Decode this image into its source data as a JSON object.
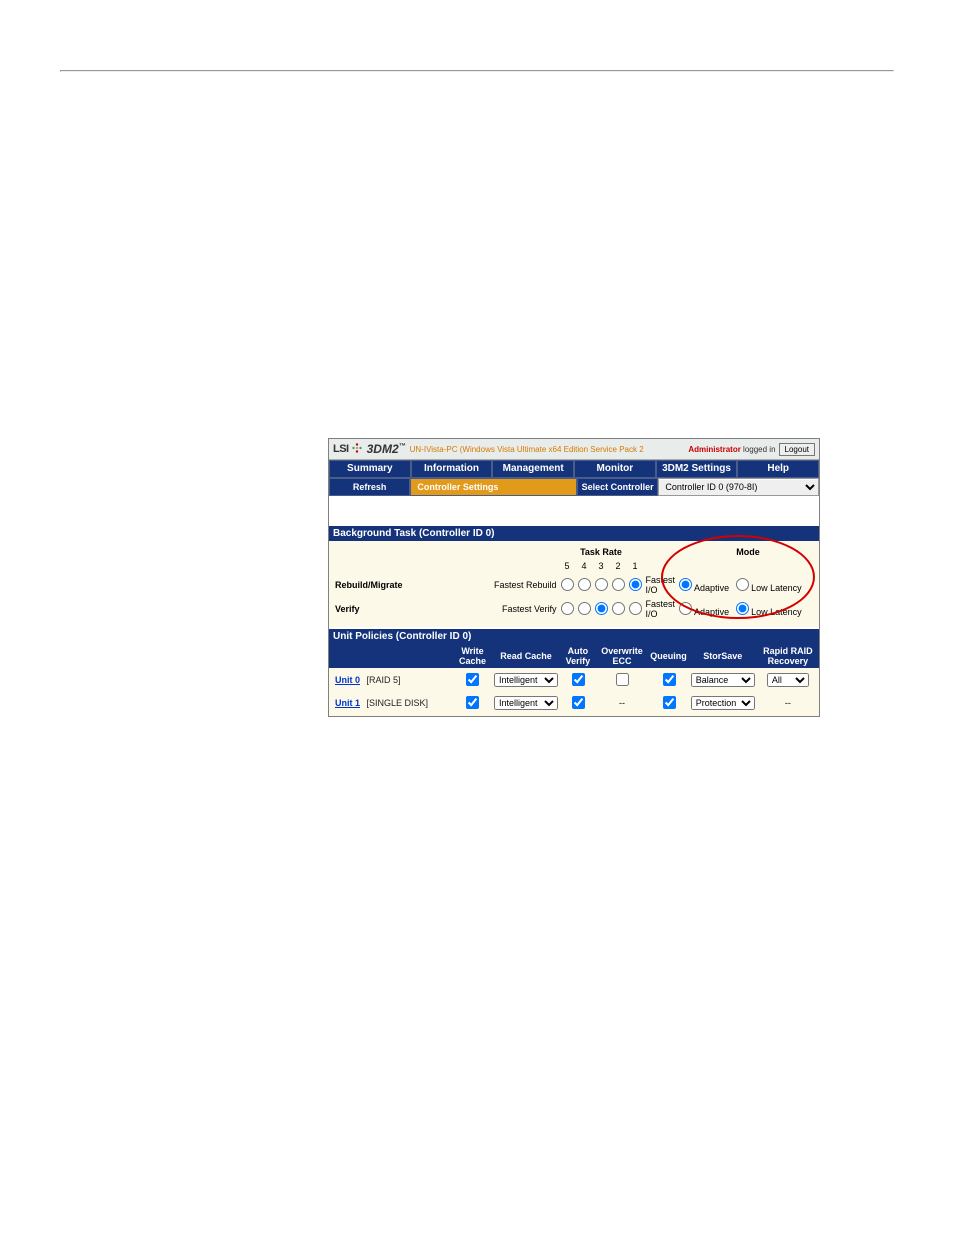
{
  "titlebar": {
    "logo": "LSI",
    "product": "3DM2",
    "tm": "™",
    "os_text": "UN-IVista-PC (Windows Vista Ultimate x64 Edition Service Pack 2",
    "login_prefix": "Administrator",
    "login_suffix": " logged in",
    "logout": "Logout"
  },
  "menu": {
    "row1": [
      "Summary",
      "Information",
      "Management",
      "Monitor",
      "3DM2 Settings",
      "Help"
    ],
    "row2_refresh": "Refresh",
    "row2_controller": "Controller Settings",
    "row2_select_label": "Select Controller",
    "row2_select_value": "Controller ID 0 (970-8I)"
  },
  "bg_task": {
    "header": "Background Task (Controller ID 0)",
    "task_rate_label": "Task Rate",
    "mode_label": "Mode",
    "ticks": [
      "5",
      "4",
      "3",
      "2",
      "1"
    ],
    "rows": [
      {
        "label": "Rebuild/Migrate",
        "left_hint": "Fastest Rebuild",
        "right_hint": "Fastest I/O",
        "selected_rate_index": 4,
        "mode_selected": "adaptive"
      },
      {
        "label": "Verify",
        "left_hint": "Fastest Verify",
        "right_hint": "Fastest I/O",
        "selected_rate_index": 2,
        "mode_selected": "low"
      }
    ],
    "mode_adaptive": "Adaptive",
    "mode_low": "Low Latency"
  },
  "policies": {
    "header": "Unit Policies (Controller ID 0)",
    "cols": [
      "",
      "Write Cache",
      "Read Cache",
      "Auto Verify",
      "Overwrite ECC",
      "Queuing",
      "StorSave",
      "Rapid RAID Recovery"
    ],
    "rows": [
      {
        "unit": "Unit 0",
        "raid": "[RAID 5]",
        "write_cache": true,
        "read_cache": "Intelligent",
        "auto_verify": true,
        "overwrite_ecc": false,
        "queuing": true,
        "storsave": "Balance",
        "rapid_raid": "All"
      },
      {
        "unit": "Unit 1",
        "raid": "[SINGLE DISK]",
        "write_cache": true,
        "read_cache": "Intelligent",
        "auto_verify": true,
        "overwrite_ecc": "--",
        "queuing": true,
        "storsave": "Protection",
        "rapid_raid": "--"
      }
    ]
  }
}
